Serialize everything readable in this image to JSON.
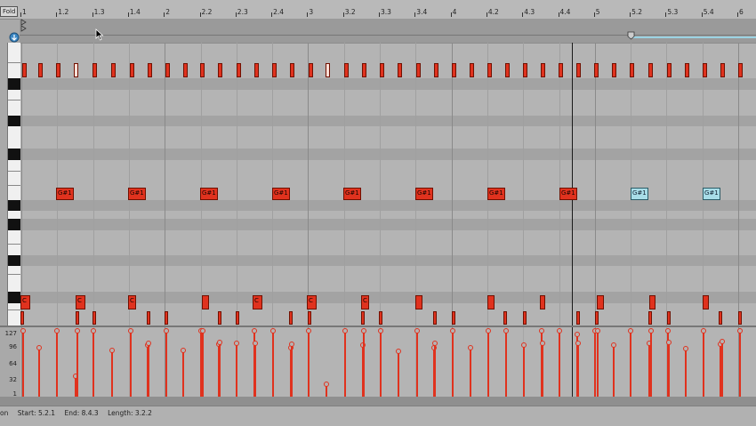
{
  "ruler": {
    "fold_label": "Fold",
    "bars": [
      "1",
      "1.2",
      "1.3",
      "1.4",
      "2",
      "2.2",
      "2.3",
      "2.4",
      "3",
      "3.2",
      "3.3",
      "3.4",
      "4",
      "4.2",
      "4.3",
      "4.4",
      "5",
      "5.2",
      "5.3",
      "5.4",
      "6"
    ]
  },
  "notes": {
    "g_sharp_label": "G#1",
    "c_label": "C"
  },
  "velocity": {
    "axis_labels": [
      "127",
      "96",
      "64",
      "32",
      "1"
    ]
  },
  "status_bar": {
    "prefix": "on",
    "start": "Start: 5.2.1",
    "end": "End: 8.4.3",
    "length": "Length: 3.2.2"
  },
  "colors": {
    "note_active": "#e0321e",
    "note_inactive": "#a8dde8",
    "grid_bg": "#b4b4b4"
  }
}
